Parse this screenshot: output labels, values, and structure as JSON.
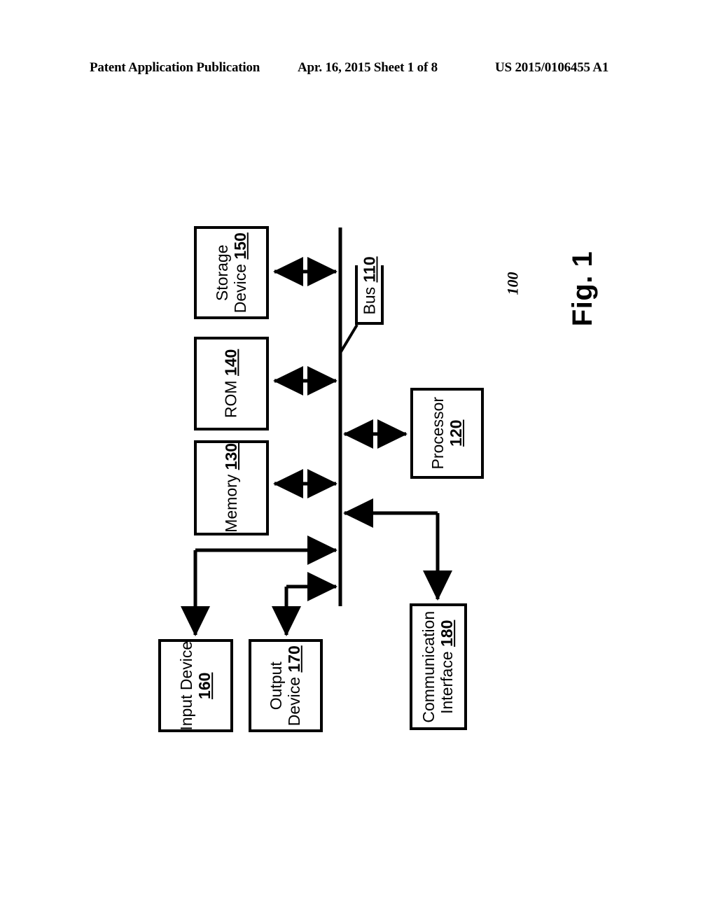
{
  "header": {
    "left": "Patent Application Publication",
    "center": "Apr. 16, 2015  Sheet 1 of 8",
    "right": "US 2015/0106455 A1"
  },
  "figure": {
    "label": "Fig. 1",
    "system_reference": "100"
  },
  "diagram": {
    "bus": {
      "name": "Bus",
      "number": "110"
    },
    "nodes": [
      {
        "id": "storage",
        "line1": "Storage",
        "line2": "Device",
        "number": "150"
      },
      {
        "id": "rom",
        "line1": "ROM",
        "line2": "",
        "number": "140"
      },
      {
        "id": "memory",
        "line1": "Memory",
        "line2": "",
        "number": "130"
      },
      {
        "id": "processor",
        "line1": "Processor",
        "line2": "",
        "number": "120"
      },
      {
        "id": "input",
        "line1": "Input Device",
        "line2": "",
        "number": "160"
      },
      {
        "id": "output",
        "line1": "Output",
        "line2": "Device",
        "number": "170"
      },
      {
        "id": "comm",
        "line1": "Communication",
        "line2": "Interface",
        "number": "180"
      }
    ]
  },
  "colors": {
    "ink": "#000000",
    "paper": "#ffffff"
  }
}
